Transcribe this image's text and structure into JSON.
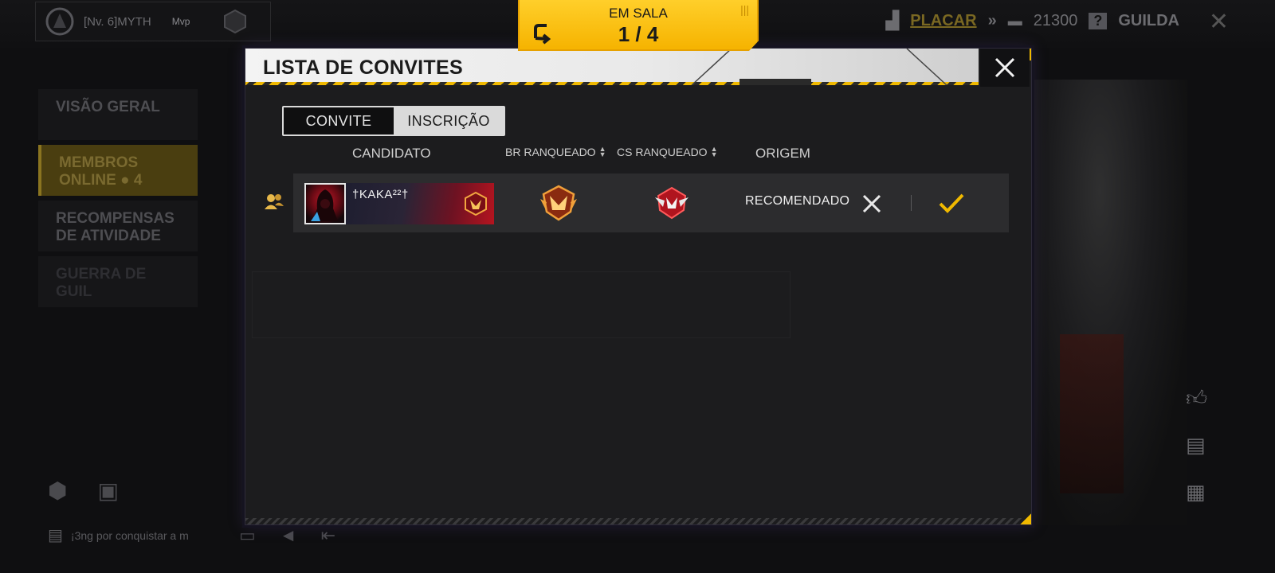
{
  "top_bar": {
    "player_name": "[Nv. 6]MYTH",
    "player_tag": "Mvp",
    "placar_label": "PLACAR",
    "coins": "21300",
    "guild_label": "GUILDA"
  },
  "sidebar": {
    "items": [
      {
        "label": "VISÃO GERAL"
      },
      {
        "label": "MEMBROS ONLINE",
        "count": "4"
      },
      {
        "label": "RECOMPENSAS DE ATIVIDADE"
      },
      {
        "label": "GUERRA DE GUIL"
      }
    ]
  },
  "chat": {
    "preview": "¡3ng por conquistar a m"
  },
  "room": {
    "title": "EM SALA",
    "count": "1 / 4"
  },
  "modal": {
    "title": "LISTA DE CONVITES",
    "tabs": [
      {
        "label": "CONVITE",
        "selected": false
      },
      {
        "label": "INSCRIÇÃO",
        "selected": true
      }
    ],
    "columns": {
      "candidate": "CANDIDATO",
      "br_rank": "BR RANQUEADO",
      "cs_rank": "CS RANQUEADO",
      "origin": "ORIGEM"
    },
    "applicants": [
      {
        "name": "†KAKA²²†",
        "br_rank_icon": "heroic-rank-icon",
        "cs_rank_icon": "cs-rank-icon",
        "origin": "RECOMENDADO"
      }
    ]
  },
  "colors": {
    "accent_yellow": "#f6b300",
    "modal_bg": "#1c1c1e",
    "row_bg": "#2c2c2e",
    "accept": "#f0b900"
  }
}
